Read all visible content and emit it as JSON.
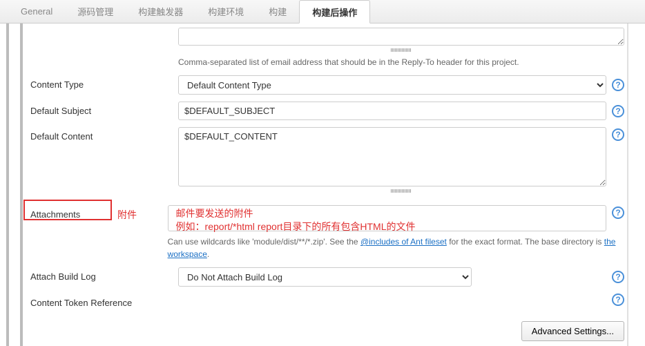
{
  "tabs": {
    "items": [
      {
        "label": "General"
      },
      {
        "label": "源码管理"
      },
      {
        "label": "构建触发器"
      },
      {
        "label": "构建环境"
      },
      {
        "label": "构建"
      },
      {
        "label": "构建后操作"
      }
    ],
    "active_index": 5
  },
  "reply_to": {
    "value": "",
    "desc": "Comma-separated list of email address that should be in the Reply-To header for this project."
  },
  "content_type": {
    "label": "Content Type",
    "value": "Default Content Type",
    "options": [
      "Default Content Type"
    ]
  },
  "default_subject": {
    "label": "Default Subject",
    "value": "$DEFAULT_SUBJECT"
  },
  "default_content": {
    "label": "Default Content",
    "value": "$DEFAULT_CONTENT"
  },
  "attachments": {
    "label": "Attachments",
    "value": "",
    "desc_pre": "Can use wildcards like 'module/dist/**/*.zip'. See the ",
    "desc_link1": "@includes of Ant fileset",
    "desc_mid": " for the exact format. The base directory is ",
    "desc_link2": "the workspace",
    "desc_post": ".",
    "annotation_side": "附件",
    "annotation_line1": "邮件要发送的附件",
    "annotation_line2": "例如：report/*html  report目录下的所有包含HTML的文件"
  },
  "attach_build_log": {
    "label": "Attach Build Log",
    "value": "Do Not Attach Build Log",
    "options": [
      "Do Not Attach Build Log"
    ]
  },
  "content_token_reference": {
    "label": "Content Token Reference"
  },
  "advanced_button": "Advanced Settings...",
  "help_glyph": "?"
}
